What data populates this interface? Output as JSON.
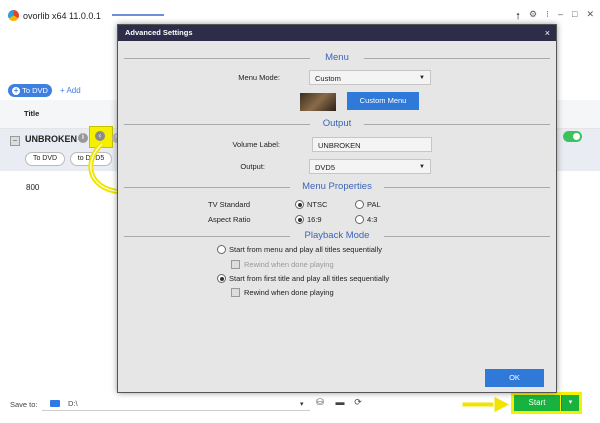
{
  "app": {
    "title": "ovorlib x64  11.0.0.1",
    "window_controls": [
      "🠕",
      "⚙",
      "⁝",
      "–",
      "□",
      "✕"
    ]
  },
  "toolbar": {
    "to_dvd": "To DVD",
    "add": "+ Add"
  },
  "list": {
    "header_title": "Title",
    "item": {
      "name": "UNBROKEN",
      "pill1": "To DVD",
      "pill2": "to DVD5",
      "value": "800"
    }
  },
  "bottom": {
    "save_to_label": "Save to:",
    "path": "D:\\",
    "start": "Start"
  },
  "colors": {
    "accent": "#3f7fe0",
    "start": "#18b23e",
    "highlight": "#f5f000",
    "section": "#3c64b9"
  },
  "dialog": {
    "title": "Advanced Settings",
    "close": "×",
    "sections": {
      "menu": "Menu",
      "output": "Output",
      "menu_properties": "Menu Properties",
      "playback_mode": "Playback Mode"
    },
    "menu_mode": {
      "label": "Menu Mode:",
      "value": "Custom"
    },
    "custom_menu_button": "Custom Menu",
    "volume_label": {
      "label": "Volume Label:",
      "value": "UNBROKEN"
    },
    "output": {
      "label": "Output:",
      "value": "DVD5"
    },
    "tv_standard": {
      "label": "TV Standard",
      "options": [
        "NTSC",
        "PAL"
      ],
      "selected": "NTSC"
    },
    "aspect_ratio": {
      "label": "Aspect Ratio",
      "options": [
        "16:9",
        "4:3"
      ],
      "selected": "16:9"
    },
    "playback": {
      "option1": "Start from menu and play all titles sequentially",
      "option1_rewind": "Rewind when done playing",
      "option2": "Start from first title and play all titles sequentially",
      "option2_rewind": "Rewind when done playing",
      "selected": 2
    },
    "ok": "OK"
  }
}
